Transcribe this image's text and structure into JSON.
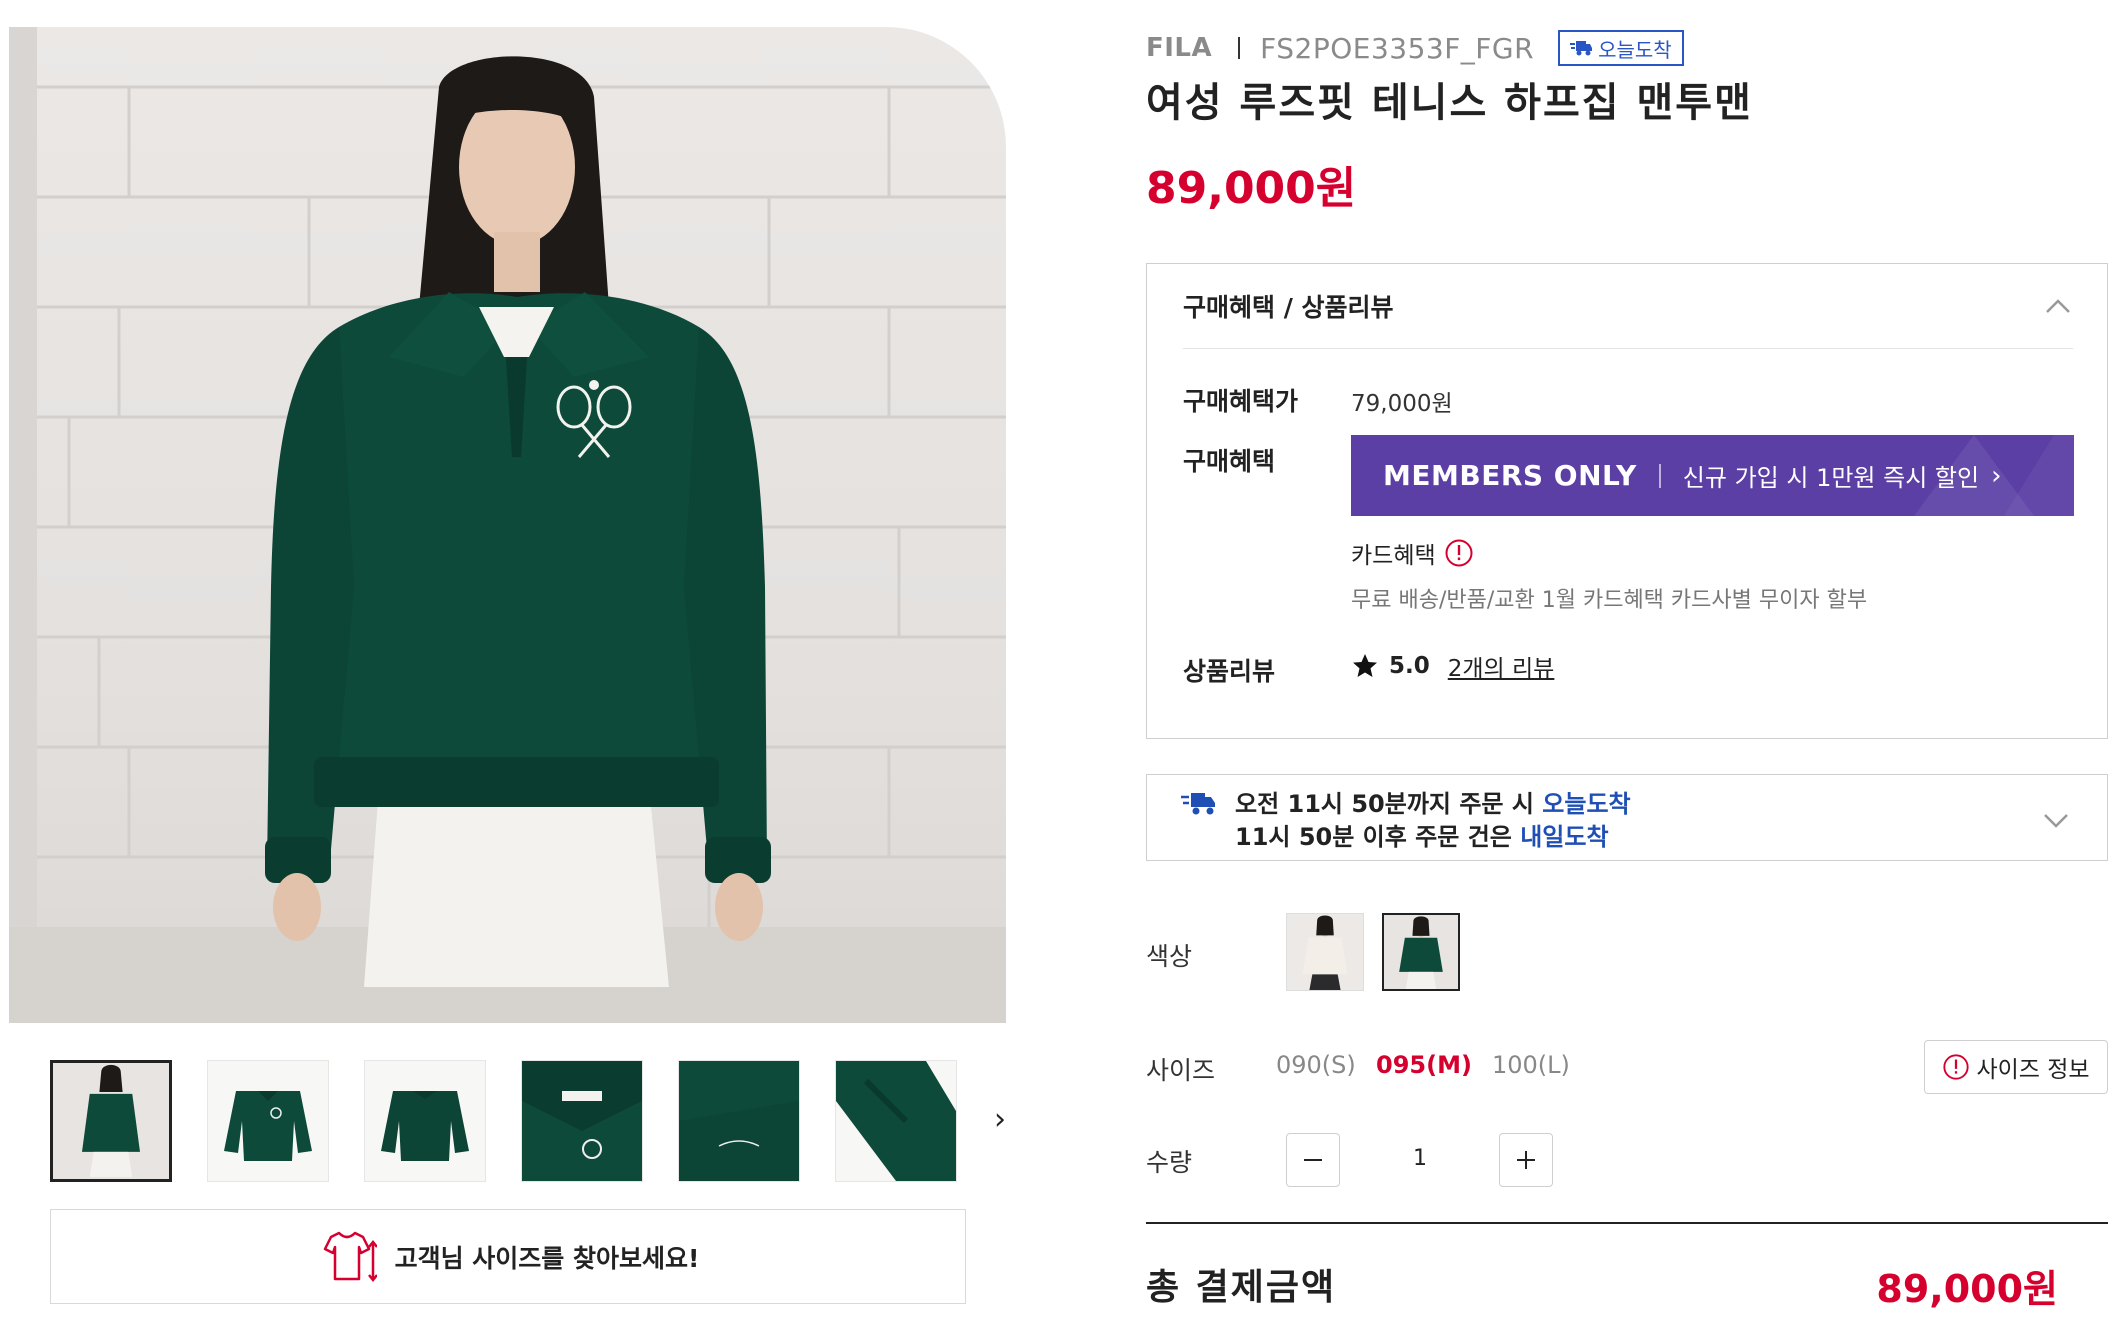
{
  "product": {
    "brand": "FILA",
    "sku": "FS2POE3353F_FGR",
    "today_badge": "오늘도착",
    "title": "여성 루즈핏 테니스 하프집 맨투맨",
    "price": "89,000원"
  },
  "gallery": {
    "main_image": "model-green-halfzip-photo",
    "thumbnails": [
      "model-front-thumb",
      "sweatshirt-front-thumb",
      "sweatshirt-flat-thumb",
      "collar-detail-thumb",
      "embroidery-detail-thumb",
      "cuff-detail-thumb"
    ],
    "selected_thumbnail": 0,
    "size_finder_label": "고객님 사이즈를 찾아보세요!"
  },
  "benefits": {
    "header": "구매혜택 / 상품리뷰",
    "benefit_price_label": "구매혜택가",
    "benefit_price_value": "79,000원",
    "benefit_label": "구매혜택",
    "members_banner": {
      "title": "MEMBERS ONLY",
      "text": "신규 가입 시 1만원 즉시 할인",
      "arrow": "›"
    },
    "card_benefit_label": "카드혜택",
    "card_benefit_desc": "무료 배송/반품/교환 1월 카드혜택 카드사별 무이자 할부",
    "review_label": "상품리뷰",
    "rating": "5.0",
    "review_link": "2개의 리뷰"
  },
  "delivery": {
    "line1_prefix": "오전 11시 50분까지 주문 시 ",
    "line1_highlight": "오늘도착",
    "line2_prefix": "11시 50분 이후 주문 건은 ",
    "line2_highlight": "내일도착"
  },
  "options": {
    "color_label": "색상",
    "colors": [
      "ivory",
      "green"
    ],
    "selected_color": "green",
    "size_label": "사이즈",
    "sizes": [
      "090(S)",
      "095(M)",
      "100(L)"
    ],
    "selected_size": "095(M)",
    "size_info_label": "사이즈 정보",
    "qty_label": "수량",
    "qty": "1"
  },
  "total": {
    "label": "총 결제금액",
    "price": "89,000원"
  },
  "colors": {
    "accent_red": "#d6002f",
    "members_purple": "#5b3fa5",
    "delivery_blue": "#1f4fb5",
    "garment_green": "#0d4a3a"
  }
}
